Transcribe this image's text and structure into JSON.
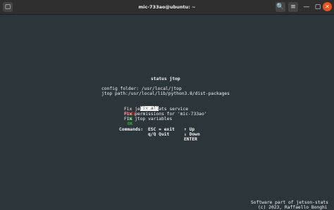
{
  "window": {
    "title": "mic-733ao@ubuntu: ~",
    "new_tab_glyph": "▢",
    "search_glyph": "🔍",
    "menu_glyph": "≡",
    "minimize_glyph": "—",
    "close_glyph": "✕",
    "accent_close": "#e95420"
  },
  "terminal": {
    "heading": "status jtop",
    "config_folder": "config folder: /usr/local/jtop",
    "jtop_path": "jtop path:/usr/local/lib/python3.8/dist-packages",
    "menu_items": [
      {
        "status": "",
        "label": "Fix all",
        "highlighted": true
      },
      {
        "status": "FAIL",
        "label": "Fix jetson-stats service"
      },
      {
        "status": "OK",
        "label": "Fix permissions for 'mic-733ao'"
      },
      {
        "status": "OK",
        "label": "Fix jtop variables"
      }
    ],
    "commands": {
      "label": "Commands:",
      "esc": "ESC = exit",
      "quit": "q/Q Quit",
      "up": "↑ Up",
      "down": "↓ Down",
      "enter": "ENTER"
    },
    "footer_line1": "Software part of jetson-stats",
    "footer_line2": "(c) 2023, Raffaello Bonghi"
  }
}
